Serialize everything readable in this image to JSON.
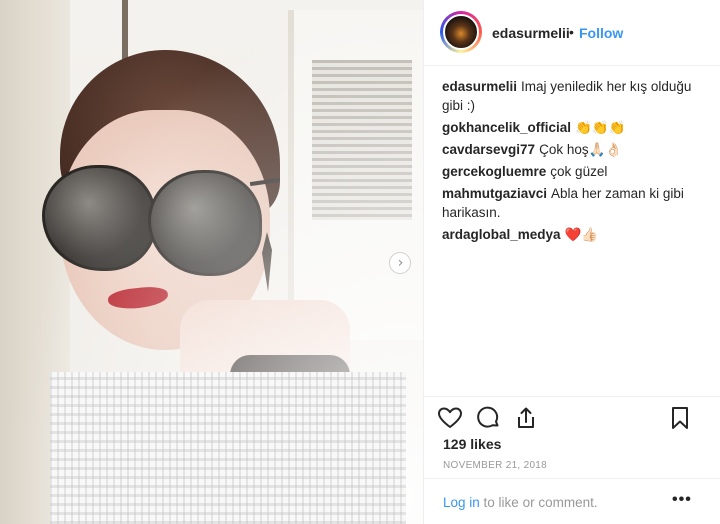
{
  "header": {
    "username": "edasurmelii",
    "separator": "•",
    "follow_label": "Follow"
  },
  "media": {
    "carousel_next": "›"
  },
  "comments": [
    {
      "user": "edasurmelii",
      "text": "Imaj yeniledik her kış olduğu gibi :)"
    },
    {
      "user": "gokhancelik_official",
      "text": "👏👏👏"
    },
    {
      "user": "cavdarsevgi77",
      "text": "Çok hoş🙏🏻👌🏻"
    },
    {
      "user": "gercekogluemre",
      "text": "çok güzel"
    },
    {
      "user": "mahmutgaziavci",
      "text": "Abla her zaman ki gibi harikasın."
    },
    {
      "user": "ardaglobal_medya",
      "text": "❤️👍🏻"
    }
  ],
  "likes": "129 likes",
  "date": "NOVEMBER 21, 2018",
  "footer": {
    "login_link": "Log in",
    "login_rest": " to like or comment.",
    "more": "•••"
  },
  "icons": {
    "like": "heart-icon",
    "comment": "comment-icon",
    "share": "share-icon",
    "save": "bookmark-icon"
  },
  "colors": {
    "link": "#3897f0",
    "text": "#262626",
    "muted": "#999999",
    "lips": "#b8232c"
  }
}
